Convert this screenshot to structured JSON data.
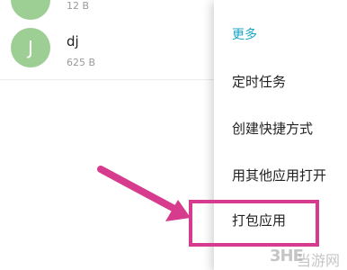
{
  "file_list": {
    "items": [
      {
        "avatar_letter": "",
        "name": "",
        "size": "12 B"
      },
      {
        "avatar_letter": "J",
        "name": "dj",
        "size": "625 B"
      }
    ]
  },
  "context_menu": {
    "header": "更多",
    "items": [
      "定时任务",
      "创建快捷方式",
      "用其他应用打开",
      "打包应用"
    ]
  },
  "watermark": {
    "logo": "3HE",
    "text": "当游网"
  },
  "colors": {
    "avatar": "#9dce94",
    "menu_header": "#1aa4c8",
    "highlight": "#d63b8d"
  }
}
